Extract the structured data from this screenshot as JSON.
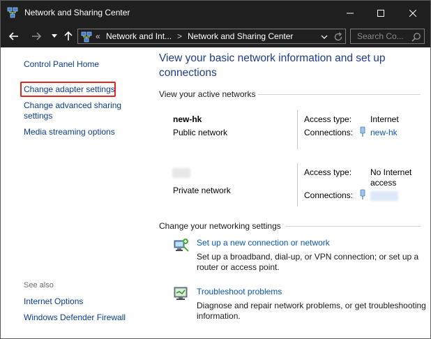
{
  "window": {
    "title": "Network and Sharing Center",
    "controls": {
      "minimize": "minimize-icon",
      "maximize": "maximize-icon",
      "close": "close-icon"
    }
  },
  "navbar": {
    "breadcrumb_prefix": "«",
    "crumb1": "Network and Int...",
    "separator": ">",
    "crumb2": "Network and Sharing Center",
    "search_placeholder": "Search Co..."
  },
  "sidebar": {
    "home": "Control Panel Home",
    "items": [
      {
        "label": "Change adapter settings",
        "highlighted": true
      },
      {
        "label": "Change advanced sharing settings"
      },
      {
        "label": "Media streaming options"
      }
    ],
    "see_also_label": "See also",
    "see_also": [
      {
        "label": "Internet Options"
      },
      {
        "label": "Windows Defender Firewall"
      }
    ]
  },
  "main": {
    "title": "View your basic network information and set up connections",
    "active_networks_label": "View your active networks",
    "networks": [
      {
        "name": "new-hk",
        "type": "Public network",
        "access_type_label": "Access type:",
        "access_type": "Internet",
        "connections_label": "Connections:",
        "connection": "new-hk"
      },
      {
        "name": "",
        "type": "Private network",
        "access_type_label": "Access type:",
        "access_type": "No Internet access",
        "connections_label": "Connections:",
        "connection": ""
      }
    ],
    "change_settings_label": "Change your networking settings",
    "tasks": [
      {
        "icon": "new-connection-icon",
        "link": "Set up a new connection or network",
        "description": "Set up a broadband, dial-up, or VPN connection; or set up a router or access point."
      },
      {
        "icon": "troubleshoot-icon",
        "link": "Troubleshoot problems",
        "description": "Diagnose and repair network problems, or get troubleshooting information."
      }
    ]
  },
  "colors": {
    "titlebar": "#1f1f1f",
    "link": "#0a3d91",
    "heading": "#1e3c8c",
    "highlight_border": "#e0261d"
  }
}
